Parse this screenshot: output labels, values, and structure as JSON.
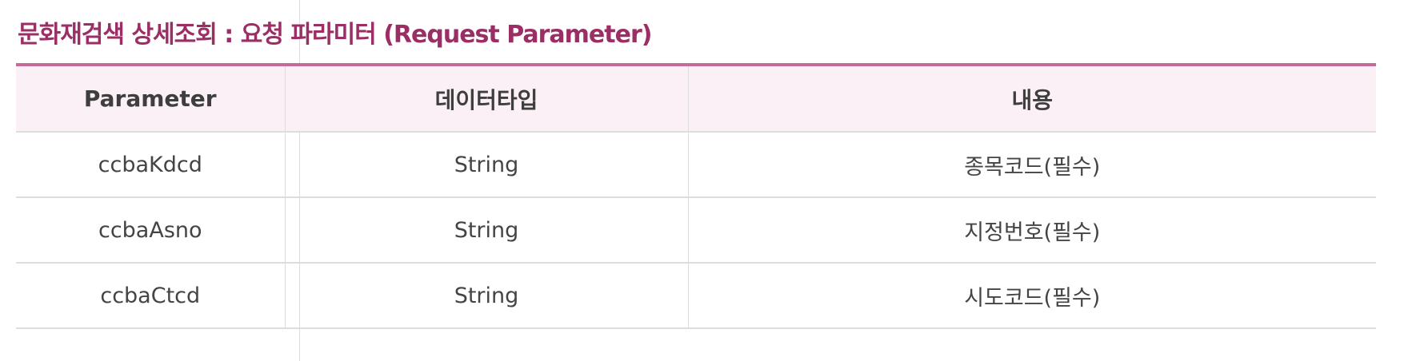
{
  "title": "문화재검색 상세조회 : 요청 파라미터 (Request Parameter)",
  "table": {
    "headers": [
      "Parameter",
      "데이터타입",
      "내용"
    ],
    "rows": [
      [
        "ccbaKdcd",
        "String",
        "종목코드(필수)"
      ],
      [
        "ccbaAsno",
        "String",
        "지정번호(필수)"
      ],
      [
        "ccbaCtcd",
        "String",
        "시도코드(필수)"
      ]
    ]
  },
  "colors": {
    "title": "#9b2e64",
    "accent_line": "#c46b97",
    "header_bg": "#fbf0f5",
    "border": "#dddddd"
  }
}
